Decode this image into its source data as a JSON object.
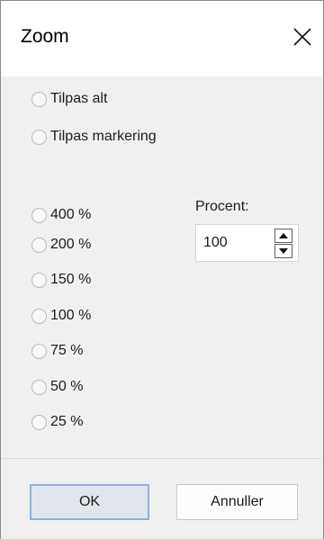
{
  "dialog": {
    "title": "Zoom",
    "close_icon": "close-icon"
  },
  "fit_options": [
    {
      "label": "Tilpas alt",
      "selected": false
    },
    {
      "label": "Tilpas markering",
      "selected": false
    }
  ],
  "zoom_options": [
    {
      "label": "400 %",
      "selected": false
    },
    {
      "label": "200 %",
      "selected": false
    },
    {
      "label": "150 %",
      "selected": false
    },
    {
      "label": "100 %",
      "selected": false
    },
    {
      "label": "75 %",
      "selected": false
    },
    {
      "label": "50 %",
      "selected": false
    },
    {
      "label": "25 %",
      "selected": false
    }
  ],
  "percent": {
    "label": "Procent:",
    "value": "100",
    "up_icon": "triangle-up-icon",
    "down_icon": "triangle-down-icon"
  },
  "buttons": {
    "ok_label": "OK",
    "cancel_label": "Annuller"
  },
  "colors": {
    "dialog_bg": "#f0f0f0",
    "titlebar_bg": "#ffffff",
    "ok_border": "#8fb3d8",
    "ok_bg": "#e1e6ec"
  }
}
